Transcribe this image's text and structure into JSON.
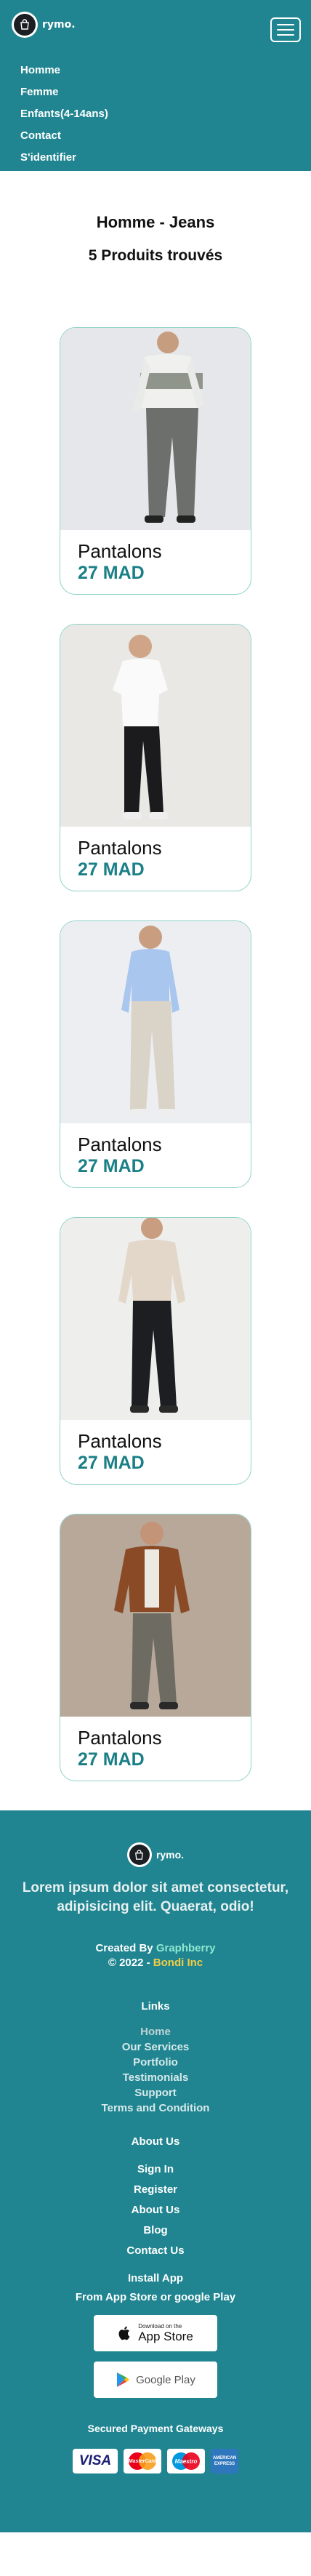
{
  "header": {
    "brand": "rymo.",
    "nav": [
      "Homme",
      "Femme",
      "Enfants(4-14ans)",
      "Contact",
      "S'identifier"
    ]
  },
  "main": {
    "category_title": "Homme - Jeans",
    "count_text": "5 Produits trouvés",
    "products": [
      {
        "name": "Pantalons",
        "price": "27 MAD"
      },
      {
        "name": "Pantalons",
        "price": "27 MAD"
      },
      {
        "name": "Pantalons",
        "price": "27 MAD"
      },
      {
        "name": "Pantalons",
        "price": "27 MAD"
      },
      {
        "name": "Pantalons",
        "price": "27 MAD"
      }
    ]
  },
  "footer": {
    "brand": "rymo.",
    "lorem": "Lorem ipsum dolor sit amet consectetur, adipisicing elit. Quaerat, odio!",
    "created_prefix": "Created By",
    "created_name": "Graphberry",
    "copyright_prefix": "© 2022 -",
    "copyright_name": "Bondi Inc",
    "links_title": "Links",
    "links": [
      "Home",
      "Our Services",
      "Portfolio",
      "Testimonials",
      "Support",
      "Terms and Condition"
    ],
    "about_title": "About Us",
    "about_links": [
      "Sign In",
      "Register",
      "About Us",
      "Blog",
      "Contact Us"
    ],
    "install_title": "Install App",
    "install_sub": "From App Store or google Play",
    "app_store_small": "Download on the",
    "app_store_big": "App Store",
    "google_play": "Google Play",
    "secured_title": "Secured Payment Gateways",
    "payments": [
      "VISA",
      "MasterCard",
      "Maestro",
      "AMERICAN EXPRESS"
    ]
  },
  "colors": {
    "teal": "#208591",
    "price": "#1a7f86",
    "highlight_created": "#8fe8d0",
    "highlight_copyright": "#f1cd44"
  }
}
